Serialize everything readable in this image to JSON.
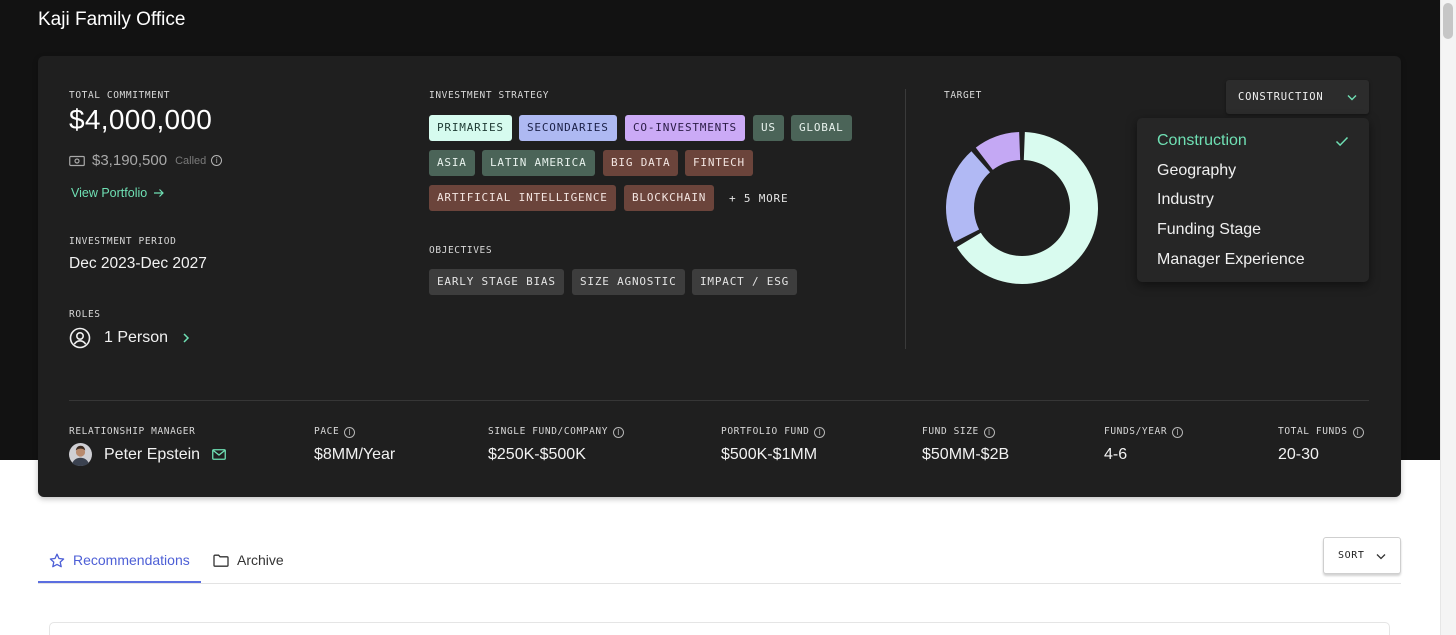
{
  "page": {
    "title": "Kaji Family Office"
  },
  "summary": {
    "total_commitment_label": "TOTAL COMMITMENT",
    "total_commitment_value": "$4,000,000",
    "called_value": "$3,190,500",
    "called_label": "Called",
    "view_portfolio_label": "View Portfolio",
    "investment_period_label": "INVESTMENT PERIOD",
    "investment_period_value": "Dec 2023-Dec 2027",
    "roles_label": "ROLES",
    "roles_value": "1 Person"
  },
  "strategy": {
    "label": "INVESTMENT STRATEGY",
    "tags": [
      "PRIMARIES",
      "SECONDARIES",
      "CO-INVESTMENTS",
      "US",
      "GLOBAL",
      "ASIA",
      "LATIN AMERICA",
      "BIG DATA",
      "FINTECH",
      "ARTIFICIAL INTELLIGENCE",
      "BLOCKCHAIN"
    ],
    "more_label": "+ 5 MORE"
  },
  "objectives": {
    "label": "OBJECTIVES",
    "tags": [
      "EARLY STAGE BIAS",
      "SIZE AGNOSTIC",
      "IMPACT / ESG"
    ]
  },
  "target": {
    "label": "TARGET",
    "dropdown_selected": "CONSTRUCTION",
    "menu_items": [
      "Construction",
      "Geography",
      "Industry",
      "Funding Stage",
      "Manager Experience"
    ],
    "selected_index": 0,
    "donut": {
      "segments": [
        {
          "value": 0.67,
          "color": "#d9fbef"
        },
        {
          "value": 0.22,
          "color": "#b1b9f4"
        },
        {
          "value": 0.11,
          "color": "#c4a8f4"
        }
      ]
    }
  },
  "details": {
    "relationship_manager_label": "RELATIONSHIP MANAGER",
    "relationship_manager_value": "Peter Epstein",
    "pace_label": "PACE",
    "pace_value": "$8MM/Year",
    "single_fund_label": "SINGLE FUND/COMPANY",
    "single_fund_value": "$250K-$500K",
    "portfolio_fund_label": "PORTFOLIO FUND",
    "portfolio_fund_value": "$500K-$1MM",
    "fund_size_label": "FUND SIZE",
    "fund_size_value": "$50MM-$2B",
    "funds_year_label": "FUNDS/YEAR",
    "funds_year_value": "4-6",
    "total_funds_label": "TOTAL FUNDS",
    "total_funds_value": "20-30"
  },
  "tabs": {
    "recommendations": "Recommendations",
    "archive": "Archive",
    "active": "recommendations"
  },
  "sort": {
    "label": "SORT"
  },
  "colors": {
    "accent_green": "#6fe0b4",
    "accent_blue": "#5b6ee0",
    "card_bg": "#1f1f1f",
    "header_bg": "#121212"
  }
}
